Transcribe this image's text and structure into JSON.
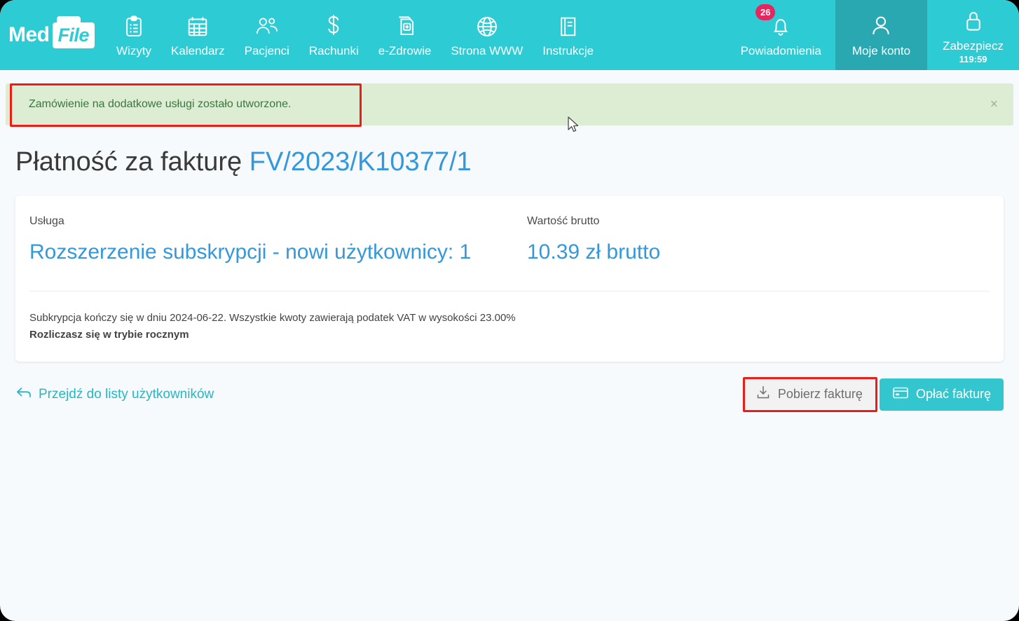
{
  "brand": {
    "logo_primary": "Med",
    "logo_secondary": "File",
    "teal": "#2DCBD3",
    "teal_active": "#2AA8B2",
    "link_blue": "#3498DB",
    "badge_pink": "#E8265E",
    "highlight_red": "#EE1C17"
  },
  "nav": {
    "items": [
      {
        "label": "Wizyty",
        "icon": "clipboard-icon"
      },
      {
        "label": "Kalendarz",
        "icon": "calendar-icon"
      },
      {
        "label": "Pacjenci",
        "icon": "patients-icon"
      },
      {
        "label": "Rachunki",
        "icon": "dollar-icon"
      },
      {
        "label": "e-Zdrowie",
        "icon": "health-plus-icon"
      },
      {
        "label": "Strona WWW",
        "icon": "globe-icon"
      },
      {
        "label": "Instrukcje",
        "icon": "book-icon"
      }
    ],
    "right": {
      "notifications": {
        "label": "Powiadomienia",
        "icon": "bell-icon",
        "badge": "26"
      },
      "account": {
        "label": "Moje konto",
        "icon": "user-icon"
      },
      "secure": {
        "label": "Zabezpiecz",
        "icon": "lock-icon",
        "timer": "119:59"
      }
    }
  },
  "alert": {
    "message": "Zamówienie na dodatkowe usługi zostało utworzone.",
    "close_icon": "close-icon",
    "close_label": "×"
  },
  "page": {
    "title_prefix": "Płatność za fakturę",
    "invoice_number": "FV/2023/K10377/1"
  },
  "card": {
    "service_label": "Usługa",
    "service_value": "Rozszerzenie subskrypcji - nowi użytkownicy: 1",
    "gross_label": "Wartość brutto",
    "gross_value": "10.39 zł brutto",
    "note_line1": "Subkrypcja kończy się w dniu 2024-06-22. Wszystkie kwoty zawierają podatek VAT w wysokości 23.00%",
    "note_line2": "Rozliczasz się w trybie rocznym"
  },
  "actions": {
    "back_label": "Przejdź do listy użytkowników",
    "back_icon": "arrow-back-icon",
    "download_label": "Pobierz fakturę",
    "download_icon": "download-icon",
    "pay_label": "Opłać fakturę",
    "pay_icon": "credit-card-icon"
  }
}
